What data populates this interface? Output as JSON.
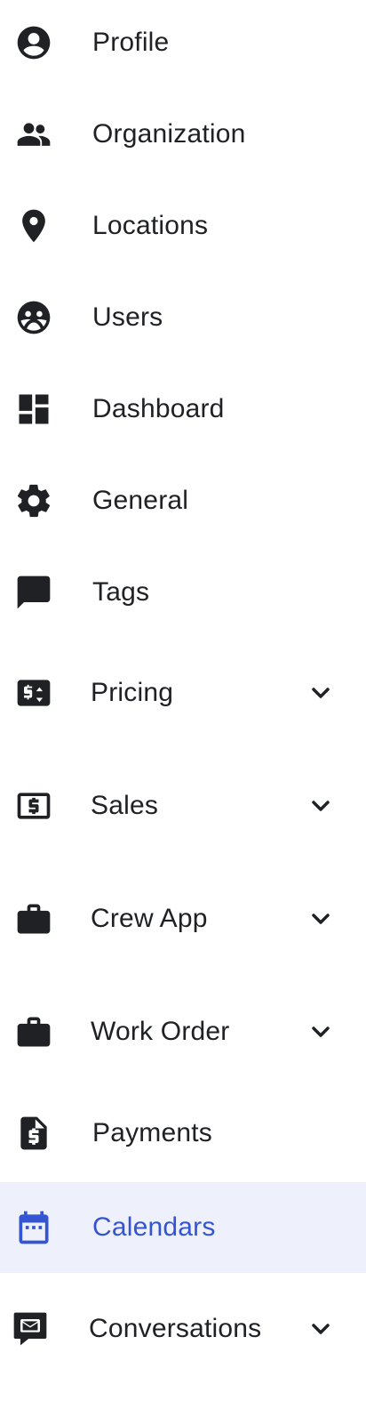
{
  "nav": {
    "items": [
      {
        "label": "Profile",
        "icon": "account-circle-icon"
      },
      {
        "label": "Organization",
        "icon": "people-icon"
      },
      {
        "label": "Locations",
        "icon": "location-pin-icon"
      },
      {
        "label": "Users",
        "icon": "users-icon"
      },
      {
        "label": "Dashboard",
        "icon": "dashboard-icon"
      },
      {
        "label": "General",
        "icon": "gear-icon"
      },
      {
        "label": "Tags",
        "icon": "chat-bubble-icon"
      },
      {
        "label": "Pricing",
        "icon": "price-tag-icon",
        "expandable": true
      },
      {
        "label": "Sales",
        "icon": "dollar-bill-icon",
        "expandable": true
      },
      {
        "label": "Crew App",
        "icon": "briefcase-icon",
        "expandable": true
      },
      {
        "label": "Work Order",
        "icon": "briefcase-icon",
        "expandable": true
      },
      {
        "label": "Payments",
        "icon": "invoice-dollar-icon"
      },
      {
        "label": "Calendars",
        "icon": "calendar-icon",
        "active": true
      },
      {
        "label": "Conversations",
        "icon": "mail-chat-icon",
        "expandable": true
      }
    ]
  },
  "colors": {
    "text": "#202124",
    "active_text": "#3454d1",
    "active_background": "#eef1fb"
  }
}
